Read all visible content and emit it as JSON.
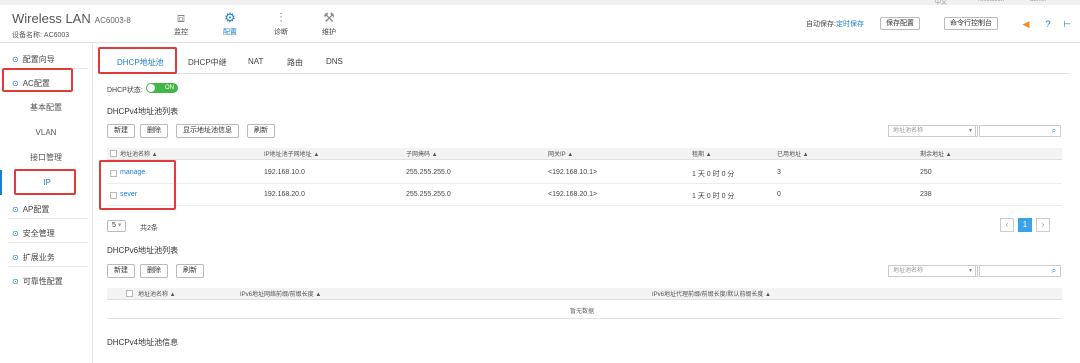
{
  "top": {
    "lang": "中文",
    "user_menu": "resolution",
    "user": "admin"
  },
  "header": {
    "brand": "Wireless LAN",
    "model": "AC6003-8",
    "device_label": "设备名称:",
    "device_name": "AC6003",
    "nav": [
      {
        "label": "监控",
        "icon": "monitor-icon"
      },
      {
        "label": "配置",
        "icon": "gear-icon"
      },
      {
        "label": "诊断",
        "icon": "sliders-icon"
      },
      {
        "label": "维护",
        "icon": "wrench-icon"
      }
    ],
    "autosave_label": "自动保存:",
    "autosave_value": "定时保存",
    "save_button": "保存配置",
    "console_button": "命令行控制台"
  },
  "sidebar": {
    "items": [
      {
        "label": "配置向导"
      },
      {
        "label": "AC配置"
      },
      {
        "label": "AP配置"
      },
      {
        "label": "安全管理"
      },
      {
        "label": "扩展业务"
      },
      {
        "label": "可靠性配置"
      }
    ],
    "subitems": [
      {
        "label": "基本配置"
      },
      {
        "label": "VLAN"
      },
      {
        "label": "接口管理"
      },
      {
        "label": "IP"
      }
    ]
  },
  "tabs": [
    "DHCP地址池",
    "DHCP中继",
    "NAT",
    "路由",
    "DNS"
  ],
  "dhcp_status_label": "DHCP状态:",
  "dhcp_toggle": "ON",
  "v4": {
    "title": "DHCPv4地址池列表",
    "buttons": [
      "新建",
      "删除",
      "显示地址池信息",
      "刷新"
    ],
    "search_placeholder": "地址池名称",
    "columns": [
      "地址池名称 ▲",
      "IP地址池子网地址 ▲",
      "子网掩码 ▲",
      "网关IP ▲",
      "租期 ▲",
      "已用地址 ▲",
      "剩余地址 ▲"
    ],
    "rows": [
      [
        "manage",
        "192.168.10.0",
        "255.255.255.0",
        "<192.168.10.1>",
        "1 天 0 时 0 分",
        "3",
        "250"
      ],
      [
        "sever",
        "192.168.20.0",
        "255.255.255.0",
        "<192.168.20.1>",
        "1 天 0 时 0 分",
        "0",
        "238"
      ]
    ],
    "page_size": "5",
    "total": "共2条",
    "current_page": "1"
  },
  "v6": {
    "title": "DHCPv6地址池列表",
    "buttons": [
      "新建",
      "删除",
      "刷新"
    ],
    "search_placeholder": "地址池名称",
    "columns": [
      "地址池名称 ▲",
      "IPv6地址网络前缀/前缀长度 ▲",
      "IPv6地址代理前缀/前缀长度/默认前缀长度 ▲"
    ],
    "empty": "暂无数据"
  },
  "v4info_title": "DHCPv4地址池信息",
  "colors": {
    "accent": "#1a7fd0",
    "highlight": "#e23a3a",
    "toggle_on": "#44b549"
  }
}
